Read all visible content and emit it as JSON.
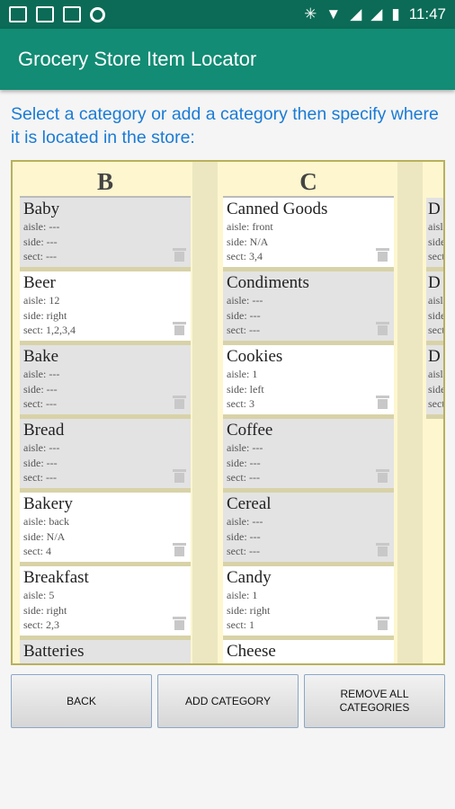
{
  "status_bar": {
    "time": "11:47",
    "left_icons": [
      "gmail-icon",
      "gmail-icon",
      "image-icon",
      "circle-icon"
    ],
    "right_icons": [
      "bluetooth-icon",
      "wifi-icon",
      "no-signal-icon",
      "no-signal-icon",
      "battery-icon"
    ]
  },
  "app_bar": {
    "title": "Grocery Store Item Locator"
  },
  "instruction": "Select a category or add a category then specify where it is located in the store:",
  "columns": [
    {
      "letter": "B",
      "items": [
        {
          "name": "Baby",
          "aisle": "aisle: ---",
          "side": "side: ---",
          "sect": "sect: ---",
          "style": "gray"
        },
        {
          "name": "Beer",
          "aisle": "aisle: 12",
          "side": "side: right",
          "sect": "sect: 1,2,3,4",
          "style": "white"
        },
        {
          "name": "Bake",
          "aisle": "aisle: ---",
          "side": "side: ---",
          "sect": "sect: ---",
          "style": "gray"
        },
        {
          "name": "Bread",
          "aisle": "aisle: ---",
          "side": "side: ---",
          "sect": "sect: ---",
          "style": "gray"
        },
        {
          "name": "Bakery",
          "aisle": "aisle: back",
          "side": "side: N/A",
          "sect": "sect: 4",
          "style": "white"
        },
        {
          "name": "Breakfast",
          "aisle": "aisle: 5",
          "side": "side: right",
          "sect": "sect: 2,3",
          "style": "white"
        },
        {
          "name": "Batteries",
          "aisle": "",
          "side": "",
          "sect": "",
          "style": "gray"
        }
      ]
    },
    {
      "letter": "C",
      "items": [
        {
          "name": "Canned Goods",
          "aisle": "aisle: front",
          "side": "side: N/A",
          "sect": "sect: 3,4",
          "style": "white"
        },
        {
          "name": "Condiments",
          "aisle": "aisle: ---",
          "side": "side: ---",
          "sect": "sect: ---",
          "style": "gray"
        },
        {
          "name": "Cookies",
          "aisle": "aisle: 1",
          "side": "side: left",
          "sect": "sect: 3",
          "style": "white"
        },
        {
          "name": "Coffee",
          "aisle": "aisle: ---",
          "side": "side: ---",
          "sect": "sect: ---",
          "style": "gray"
        },
        {
          "name": "Cereal",
          "aisle": "aisle: ---",
          "side": "side: ---",
          "sect": "sect: ---",
          "style": "gray"
        },
        {
          "name": "Candy",
          "aisle": "aisle: 1",
          "side": "side: right",
          "sect": "sect: 1",
          "style": "white"
        },
        {
          "name": "Cheese",
          "aisle": "",
          "side": "",
          "sect": "",
          "style": "white"
        }
      ]
    },
    {
      "letter": "",
      "items": [
        {
          "name": "D",
          "aisle": "aisl",
          "side": "side",
          "sect": "sect",
          "style": "gray"
        },
        {
          "name": "D",
          "aisle": "aisl",
          "side": "side",
          "sect": "sect",
          "style": "gray"
        },
        {
          "name": "D",
          "aisle": "aisl",
          "side": "side",
          "sect": "sect",
          "style": "gray"
        }
      ]
    }
  ],
  "buttons": {
    "back": "BACK",
    "add_category": "ADD CATEGORY",
    "remove_all": "REMOVE ALL CATEGORIES"
  }
}
